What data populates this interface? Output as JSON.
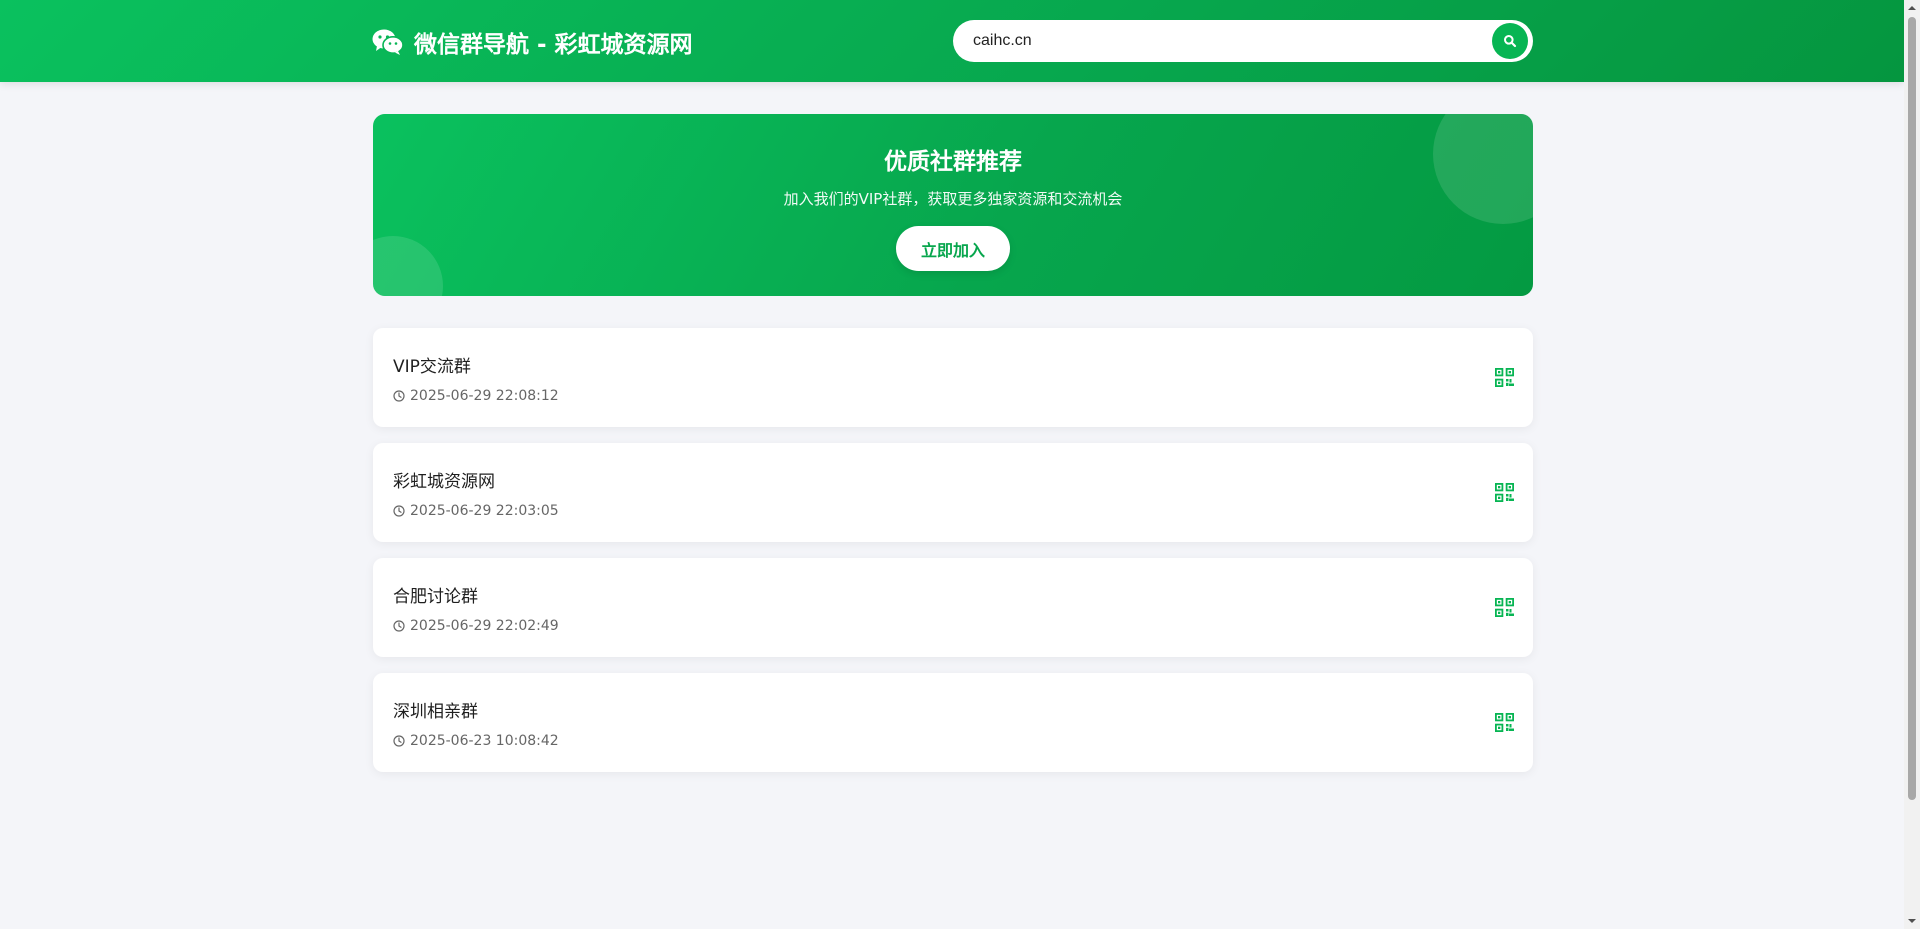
{
  "header": {
    "site_title": "微信群导航 - 彩虹城资源网",
    "logo_icon": "wechat-icon",
    "search": {
      "value": "caihc.cn",
      "placeholder": "",
      "button_icon": "search-icon"
    }
  },
  "banner": {
    "title": "优质社群推荐",
    "subtitle": "加入我们的VIP社群，获取更多独家资源和交流机会",
    "button_label": "立即加入"
  },
  "groups": [
    {
      "name": "VIP交流群",
      "time": "2025-06-29 22:08:12",
      "action_icon": "qrcode-icon"
    },
    {
      "name": "彩虹城资源网",
      "time": "2025-06-29 22:03:05",
      "action_icon": "qrcode-icon"
    },
    {
      "name": "合肥讨论群",
      "time": "2025-06-29 22:02:49",
      "action_icon": "qrcode-icon"
    },
    {
      "name": "深圳相亲群",
      "time": "2025-06-23 10:08:42",
      "action_icon": "qrcode-icon"
    }
  ],
  "colors": {
    "brand_green": "#07c160",
    "brand_green_dark": "#05963f",
    "page_background": "#f4f5f9",
    "card_background": "#ffffff"
  }
}
